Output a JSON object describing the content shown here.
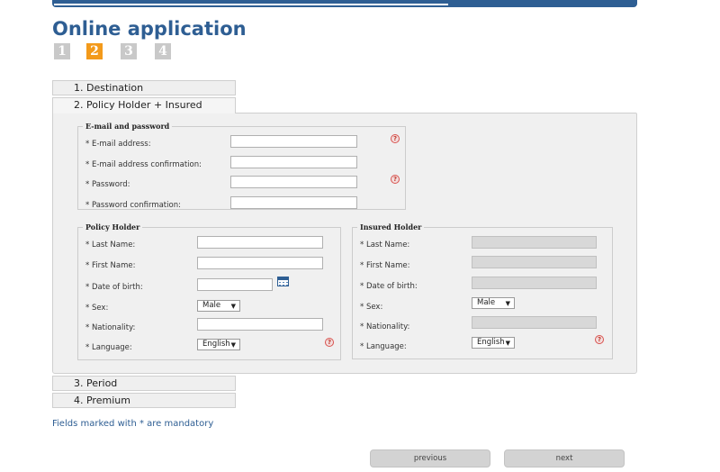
{
  "header": {
    "title": "Online application"
  },
  "steps": [
    "1",
    "2",
    "3",
    "4"
  ],
  "accordion": {
    "destination": "1. Destination",
    "policy_insured": "2. Policy Holder + Insured",
    "period": "3. Period",
    "premium": "4. Premium"
  },
  "email_section": {
    "legend": "E-mail and password",
    "email_label": "* E-mail address:",
    "email_confirm_label": "* E-mail address confirmation:",
    "password_label": "* Password:",
    "password_confirm_label": "* Password confirmation:"
  },
  "policy_holder": {
    "legend": "Policy Holder",
    "last_name_label": "* Last Name:",
    "first_name_label": "* First Name:",
    "dob_label": "* Date of birth:",
    "sex_label": "* Sex:",
    "sex_value": "Male",
    "nationality_label": "* Nationality:",
    "language_label": "* Language:",
    "language_value": "English"
  },
  "insured_holder": {
    "legend": "Insured Holder",
    "last_name_label": "* Last Name:",
    "first_name_label": "* First Name:",
    "dob_label": "* Date of birth:",
    "sex_label": "* Sex:",
    "sex_value": "Male",
    "nationality_label": "* Nationality:",
    "language_label": "* Language:",
    "language_value": "English"
  },
  "help_glyph": "?",
  "dropdown_arrow": "▼",
  "footer": {
    "mandatory_note": "Fields marked with * are mandatory",
    "previous_label": "previous",
    "next_label": "next"
  },
  "colors": {
    "brand": "#2e5e93",
    "active_step": "#f39a1b",
    "inactive_step": "#c9c9c9",
    "help": "#c0392b"
  }
}
